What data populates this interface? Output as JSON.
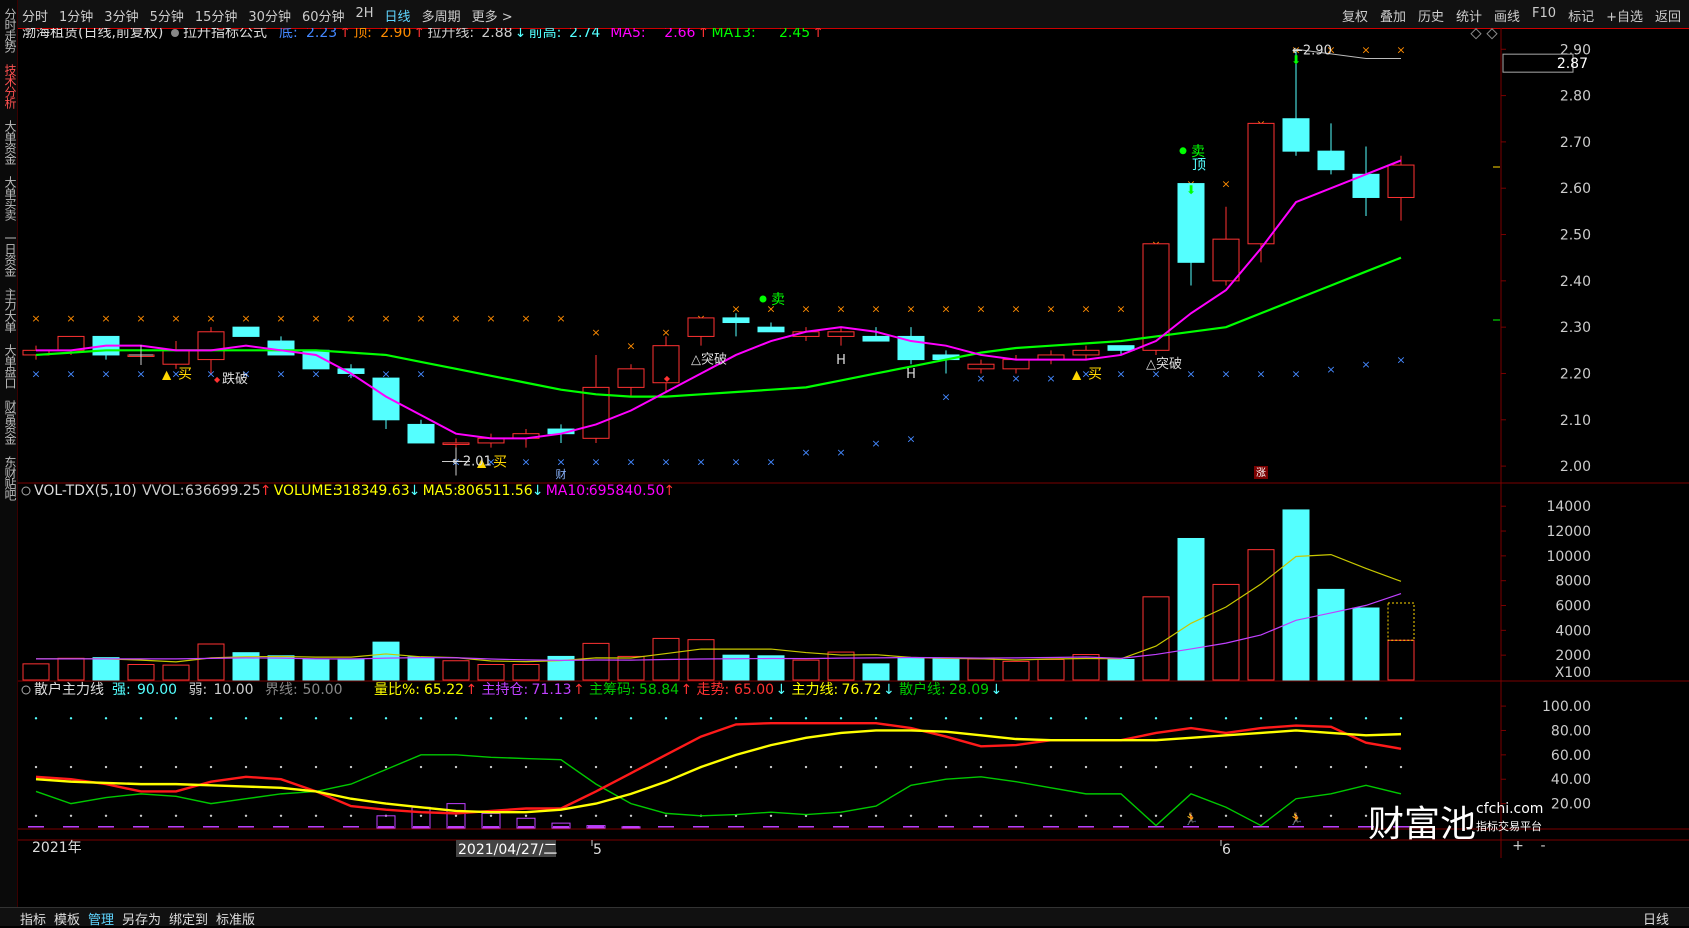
{
  "toolbar": {
    "left_items": [
      "分时",
      "1分钟",
      "3分钟",
      "5分钟",
      "15分钟",
      "30分钟",
      "60分钟",
      "2H",
      "日线",
      "多周期",
      "更多 >"
    ],
    "active_index": 8,
    "right_items": [
      "复权",
      "叠加",
      "历史",
      "统计",
      "画线",
      "F10",
      "标记",
      "+自选",
      "返回"
    ]
  },
  "sidebar": {
    "items": [
      "分时走势",
      "技术分析",
      "大单资金",
      "大单买卖",
      "一日资金",
      "主力大单",
      "大单盘口",
      "财富资金",
      "东财贴吧"
    ],
    "active_index": 1
  },
  "colors": {
    "up": "#ff3232",
    "down": "#54ffff",
    "ma5": "#ff00ff",
    "ma13": "#00ff00",
    "yellow": "#ffff00",
    "green": "#00c800",
    "purple": "#c040ff",
    "orange": "#ff8c00",
    "blue": "#4488ff"
  },
  "main_panel": {
    "stock_name": "渤海租赁",
    "period": "(日线,前复权)",
    "formula": "拉升指标公式",
    "indicators": [
      {
        "label": "底:",
        "value": "2.23",
        "arrow": "↑",
        "color": "#4488ff"
      },
      {
        "label": "顶:",
        "value": "2.90",
        "arrow": "↑",
        "color": "#ff8c00"
      },
      {
        "label": "拉升线:",
        "value": "2.88",
        "arrow": "↓",
        "color": "#cccccc"
      },
      {
        "label": "前高:",
        "value": "2.74",
        "arrow": "",
        "color": "#54ffff"
      },
      {
        "label": "MA5:",
        "value": "2.66",
        "arrow": "↑",
        "color": "#ff00ff"
      },
      {
        "label": "MA13:",
        "value": "2.45",
        "arrow": "↑",
        "color": "#00ff00"
      }
    ],
    "price_label": "2.87",
    "annotations": {
      "buy": "买",
      "sell": "卖",
      "break": "突破",
      "top": "顶",
      "break_down": "破",
      "h": "H",
      "cai": "财",
      "zhang": "涨",
      "low_value": "2.01",
      "high_value": "2.90"
    }
  },
  "volume_panel": {
    "title": "VOL-TDX(5,10)",
    "indicators": [
      {
        "label": "VVOL:",
        "value": "636699.25",
        "arrow": "↑",
        "color": "#cccccc"
      },
      {
        "label": "VOLUME:",
        "value": "318349.63",
        "arrow": "↓",
        "color": "#ffff00"
      },
      {
        "label": "MA5:",
        "value": "806511.56",
        "arrow": "↓",
        "color": "#ffff00"
      },
      {
        "label": "MA10:",
        "value": "695840.50",
        "arrow": "↑",
        "color": "#ff00ff"
      }
    ],
    "unit": "X100"
  },
  "osc_panel": {
    "title": "散户主力线",
    "indicators": [
      {
        "label": "强:",
        "value": "90.00",
        "arrow": "",
        "color": "#54ffff"
      },
      {
        "label": "弱:",
        "value": "10.00",
        "arrow": "",
        "color": "#cccccc"
      },
      {
        "label": "界线:",
        "value": "50.00",
        "arrow": "",
        "color": "#888888"
      },
      {
        "label": "量比%:",
        "value": "65.22",
        "arrow": "↑",
        "color": "#ffff00"
      },
      {
        "label": "主持仓:",
        "value": "71.13",
        "arrow": "↑",
        "color": "#c040ff"
      },
      {
        "label": "主筹码:",
        "value": "58.84",
        "arrow": "↑",
        "color": "#00c800"
      },
      {
        "label": "走势:",
        "value": "65.00",
        "arrow": "↓",
        "color": "#ff3232"
      },
      {
        "label": "主力线:",
        "value": "76.72",
        "arrow": "↓",
        "color": "#ffff00"
      },
      {
        "label": "散户线:",
        "value": "28.09",
        "arrow": "↓",
        "color": "#00c800"
      }
    ]
  },
  "date_axis": {
    "year": "2021年",
    "cursor_date": "2021/04/27/二",
    "month5": "5",
    "month6": "6"
  },
  "watermark": {
    "brand": "财富池",
    "site": "cfchi.com",
    "tagline": "指标交易平台"
  },
  "bottom_tabs": {
    "items": [
      "指标",
      "模板",
      "管理",
      "另存为",
      "绑定到",
      "标准版"
    ],
    "active_index": 2,
    "right": "日线"
  },
  "chart_data": [
    {
      "type": "candlestick",
      "title": "渤海租赁 (日线,前复权)",
      "ylim": [
        1.97,
        2.92
      ],
      "yticks": [
        2.0,
        2.1,
        2.2,
        2.3,
        2.4,
        2.5,
        2.6,
        2.7,
        2.8,
        2.9
      ],
      "candles": [
        {
          "o": 2.24,
          "h": 2.26,
          "l": 2.23,
          "c": 2.25
        },
        {
          "o": 2.25,
          "h": 2.28,
          "l": 2.24,
          "c": 2.28
        },
        {
          "o": 2.28,
          "h": 2.28,
          "l": 2.23,
          "c": 2.24
        },
        {
          "o": 2.24,
          "h": 2.25,
          "l": 2.22,
          "c": 2.24
        },
        {
          "o": 2.22,
          "h": 2.27,
          "l": 2.21,
          "c": 2.25
        },
        {
          "o": 2.23,
          "h": 2.3,
          "l": 2.2,
          "c": 2.29
        },
        {
          "o": 2.3,
          "h": 2.3,
          "l": 2.28,
          "c": 2.28
        },
        {
          "o": 2.27,
          "h": 2.28,
          "l": 2.24,
          "c": 2.24
        },
        {
          "o": 2.25,
          "h": 2.25,
          "l": 2.21,
          "c": 2.21
        },
        {
          "o": 2.21,
          "h": 2.22,
          "l": 2.19,
          "c": 2.2
        },
        {
          "o": 2.19,
          "h": 2.19,
          "l": 2.08,
          "c": 2.1
        },
        {
          "o": 2.09,
          "h": 2.1,
          "l": 2.05,
          "c": 2.05
        },
        {
          "o": 2.05,
          "h": 2.06,
          "l": 2.01,
          "c": 2.05
        },
        {
          "o": 2.05,
          "h": 2.07,
          "l": 2.04,
          "c": 2.06
        },
        {
          "o": 2.06,
          "h": 2.08,
          "l": 2.04,
          "c": 2.07
        },
        {
          "o": 2.08,
          "h": 2.09,
          "l": 2.05,
          "c": 2.07
        },
        {
          "o": 2.06,
          "h": 2.24,
          "l": 2.05,
          "c": 2.17
        },
        {
          "o": 2.17,
          "h": 2.22,
          "l": 2.15,
          "c": 2.21
        },
        {
          "o": 2.18,
          "h": 2.28,
          "l": 2.16,
          "c": 2.26
        },
        {
          "o": 2.28,
          "h": 2.31,
          "l": 2.26,
          "c": 2.32
        },
        {
          "o": 2.32,
          "h": 2.33,
          "l": 2.28,
          "c": 2.31
        },
        {
          "o": 2.3,
          "h": 2.31,
          "l": 2.29,
          "c": 2.29
        },
        {
          "o": 2.28,
          "h": 2.3,
          "l": 2.27,
          "c": 2.29
        },
        {
          "o": 2.28,
          "h": 2.3,
          "l": 2.26,
          "c": 2.29
        },
        {
          "o": 2.28,
          "h": 2.3,
          "l": 2.27,
          "c": 2.27
        },
        {
          "o": 2.28,
          "h": 2.3,
          "l": 2.22,
          "c": 2.23
        },
        {
          "o": 2.24,
          "h": 2.25,
          "l": 2.2,
          "c": 2.23
        },
        {
          "o": 2.21,
          "h": 2.23,
          "l": 2.2,
          "c": 2.22
        },
        {
          "o": 2.21,
          "h": 2.24,
          "l": 2.2,
          "c": 2.23
        },
        {
          "o": 2.23,
          "h": 2.25,
          "l": 2.22,
          "c": 2.24
        },
        {
          "o": 2.24,
          "h": 2.26,
          "l": 2.23,
          "c": 2.25
        },
        {
          "o": 2.26,
          "h": 2.26,
          "l": 2.24,
          "c": 2.25
        },
        {
          "o": 2.25,
          "h": 2.48,
          "l": 2.24,
          "c": 2.48
        },
        {
          "o": 2.61,
          "h": 2.61,
          "l": 2.39,
          "c": 2.44
        },
        {
          "o": 2.4,
          "h": 2.56,
          "l": 2.39,
          "c": 2.49
        },
        {
          "o": 2.48,
          "h": 2.74,
          "l": 2.44,
          "c": 2.74
        },
        {
          "o": 2.75,
          "h": 2.9,
          "l": 2.67,
          "c": 2.68
        },
        {
          "o": 2.68,
          "h": 2.74,
          "l": 2.63,
          "c": 2.64
        },
        {
          "o": 2.63,
          "h": 2.69,
          "l": 2.54,
          "c": 2.58
        },
        {
          "o": 2.58,
          "h": 2.67,
          "l": 2.53,
          "c": 2.65
        }
      ],
      "ma5": [
        2.25,
        2.25,
        2.26,
        2.26,
        2.25,
        2.25,
        2.26,
        2.25,
        2.24,
        2.2,
        2.15,
        2.11,
        2.07,
        2.06,
        2.06,
        2.07,
        2.09,
        2.12,
        2.16,
        2.2,
        2.24,
        2.27,
        2.29,
        2.3,
        2.29,
        2.27,
        2.26,
        2.24,
        2.23,
        2.23,
        2.23,
        2.24,
        2.27,
        2.33,
        2.38,
        2.47,
        2.57,
        2.6,
        2.63,
        2.66
      ],
      "ma13": [
        2.24,
        2.245,
        2.25,
        2.25,
        2.25,
        2.25,
        2.25,
        2.25,
        2.25,
        2.245,
        2.24,
        2.225,
        2.21,
        2.195,
        2.18,
        2.165,
        2.155,
        2.15,
        2.15,
        2.155,
        2.16,
        2.165,
        2.17,
        2.185,
        2.2,
        2.215,
        2.23,
        2.245,
        2.255,
        2.26,
        2.265,
        2.27,
        2.28,
        2.29,
        2.3,
        2.33,
        2.36,
        2.39,
        2.42,
        2.45
      ],
      "top_x": [
        2.32,
        2.32,
        2.32,
        2.32,
        2.32,
        2.32,
        2.32,
        2.32,
        2.32,
        2.32,
        2.32,
        2.32,
        2.32,
        2.32,
        2.32,
        2.32,
        2.29,
        2.26,
        2.29,
        2.32,
        2.34,
        2.34,
        2.34,
        2.34,
        2.34,
        2.34,
        2.34,
        2.34,
        2.34,
        2.34,
        2.34,
        2.34,
        2.48,
        2.61,
        2.61,
        2.74,
        2.9,
        2.9,
        2.9,
        2.9
      ],
      "bottom_x": [
        2.2,
        2.2,
        2.2,
        2.2,
        2.2,
        2.2,
        2.2,
        2.2,
        2.2,
        2.2,
        2.2,
        2.2,
        2.01,
        2.01,
        2.01,
        2.01,
        2.01,
        2.01,
        2.01,
        2.01,
        2.01,
        2.01,
        2.03,
        2.03,
        2.05,
        2.06,
        2.15,
        2.19,
        2.19,
        2.19,
        2.2,
        2.2,
        2.2,
        2.2,
        2.2,
        2.2,
        2.2,
        2.21,
        2.22,
        2.23
      ],
      "lashen_line": [
        2.9,
        2.89,
        2.88,
        2.88
      ],
      "lashen_start_index": 36
    },
    {
      "type": "bar",
      "title": "VOL-TDX(5,10)",
      "unit": "X100",
      "ylim": [
        0,
        14500
      ],
      "yticks": [
        2000,
        4000,
        6000,
        8000,
        10000,
        12000,
        14000
      ],
      "volume": [
        1300,
        1750,
        1800,
        1250,
        1200,
        2900,
        2200,
        1950,
        1650,
        1700,
        3050,
        1850,
        1550,
        1250,
        1250,
        1900,
        2950,
        1900,
        3350,
        3250,
        2000,
        1950,
        1600,
        2250,
        1300,
        1800,
        1750,
        1700,
        1500,
        1650,
        2050,
        1650,
        6700,
        11400,
        7700,
        10500,
        13700,
        7300,
        5800,
        3200
      ],
      "ma5": [
        1700,
        1700,
        1700,
        1600,
        1460,
        1780,
        1870,
        1900,
        1840,
        1840,
        2100,
        1870,
        1800,
        1530,
        1480,
        1560,
        1780,
        1770,
        2130,
        2490,
        2490,
        2490,
        2210,
        2010,
        2040,
        1820,
        1740,
        1710,
        1610,
        1690,
        1730,
        1710,
        2730,
        4570,
        5880,
        7730,
        9950,
        10100,
        8990,
        7950
      ],
      "ma10": [
        1700,
        1700,
        1700,
        1700,
        1700,
        1740,
        1780,
        1760,
        1700,
        1690,
        1760,
        1800,
        1790,
        1690,
        1620,
        1580,
        1610,
        1600,
        1650,
        1690,
        1710,
        1730,
        1720,
        1760,
        1780,
        1810,
        1790,
        1760,
        1780,
        1810,
        1850,
        1740,
        2060,
        2500,
        2970,
        3630,
        4810,
        5400,
        6010,
        6960
      ]
    },
    {
      "type": "line",
      "title": "散户主力线",
      "ylim": [
        0,
        105
      ],
      "yticks": [
        20,
        40,
        60,
        80,
        100
      ],
      "levels": {
        "strong": 90,
        "weak": 10,
        "boundary": 50
      },
      "zoushi_red": [
        42,
        40,
        36,
        30,
        30,
        38,
        42,
        40,
        30,
        18,
        15,
        13,
        12,
        14,
        16,
        16,
        30,
        45,
        60,
        75,
        85,
        86,
        86,
        86,
        86,
        82,
        75,
        67,
        68,
        72,
        72,
        72,
        78,
        82,
        78,
        82,
        84,
        83,
        70,
        65
      ],
      "zhulixian_yellow": [
        40,
        38,
        37,
        36,
        36,
        35,
        34,
        33,
        30,
        24,
        20,
        17,
        14,
        13,
        13,
        15,
        20,
        28,
        38,
        50,
        60,
        68,
        74,
        78,
        80,
        80,
        79,
        76,
        73,
        72,
        72,
        72,
        72,
        74,
        76,
        78,
        80,
        78,
        76,
        77
      ],
      "sanhu_green": [
        30,
        20,
        25,
        28,
        26,
        20,
        24,
        28,
        30,
        36,
        48,
        60,
        60,
        58,
        57,
        56,
        36,
        20,
        12,
        10,
        11,
        13,
        11,
        13,
        18,
        35,
        40,
        42,
        38,
        33,
        28,
        28,
        2,
        28,
        17,
        2,
        24,
        28,
        35,
        28
      ],
      "zhuchicang_bars": [
        0,
        0,
        0,
        0,
        0,
        0,
        0,
        0,
        0,
        0,
        10,
        17,
        20,
        12,
        8,
        4,
        2,
        1,
        0,
        0,
        0,
        0,
        0,
        0,
        0,
        0,
        0,
        0,
        0,
        0,
        0,
        0,
        0,
        0,
        0,
        0,
        0,
        0,
        0,
        0
      ]
    }
  ]
}
